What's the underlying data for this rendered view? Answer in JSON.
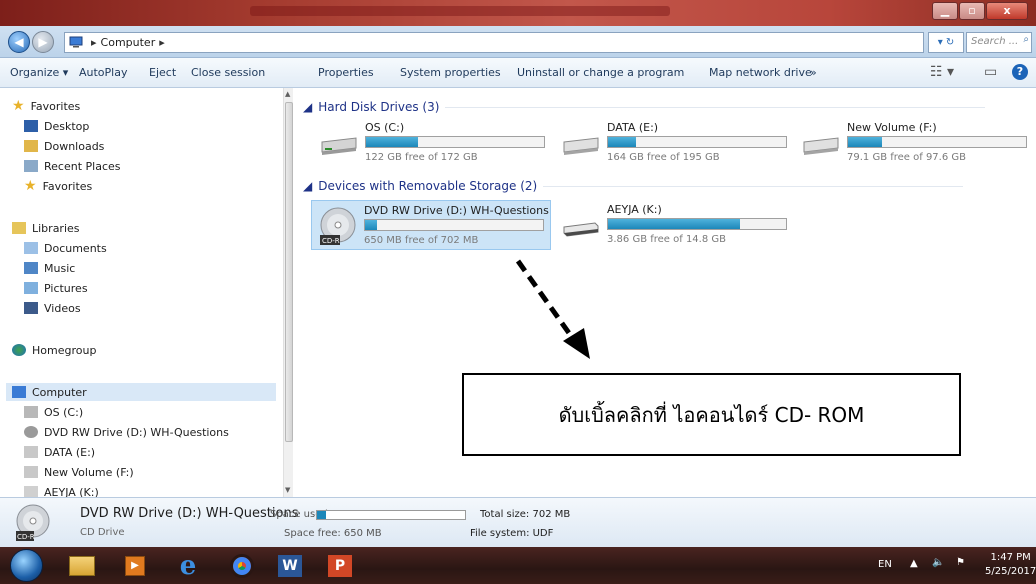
{
  "window": {
    "close_glyph": "x"
  },
  "address": {
    "crumb_sep": "▸",
    "location": "Computer",
    "search_placeholder": "Search ..."
  },
  "toolbar": {
    "items": [
      "Organize ▾",
      "AutoPlay",
      "Eject",
      "Close session",
      "Properties",
      "System properties",
      "Uninstall or change a program",
      "Map network drive",
      "»"
    ]
  },
  "nav": {
    "favorites_header": "Favorites",
    "favorites": [
      "Desktop",
      "Downloads",
      "Recent Places",
      "Favorites"
    ],
    "libraries_header": "Libraries",
    "libraries": [
      "Documents",
      "Music",
      "Pictures",
      "Videos"
    ],
    "homegroup": "Homegroup",
    "computer_header": "Computer",
    "computer": [
      "OS (C:)",
      "DVD RW Drive (D:) WH-Questions",
      "DATA (E:)",
      "New Volume (F:)",
      "AEYJA (K:)"
    ]
  },
  "groups": {
    "hdd_title": "Hard Disk Drives (3)",
    "removable_title": "Devices with Removable Storage (2)"
  },
  "drives": [
    {
      "name": "OS (C:)",
      "free": "122 GB free of 172 GB",
      "used_fraction": 0.29
    },
    {
      "name": "DATA (E:)",
      "free": "164 GB free of 195 GB",
      "used_fraction": 0.16
    },
    {
      "name": "New Volume (F:)",
      "free": "79.1 GB free of 97.6 GB",
      "used_fraction": 0.19
    },
    {
      "name": "DVD RW Drive (D:) WH-Questions",
      "free": "650 MB free of 702 MB",
      "used_fraction": 0.07,
      "disc_label": "CD-R"
    },
    {
      "name": "AEYJA (K:)",
      "free": "3.86 GB free of 14.8 GB",
      "used_fraction": 0.74
    }
  ],
  "annotation": {
    "text": "ดับเบิ้ลคลิกที่ ไอคอนไดร์ CD- ROM"
  },
  "details": {
    "title": "DVD RW Drive (D:) WH-Questions",
    "subtitle": "CD Drive",
    "space_used_label": "Space used:",
    "space_free": "Space free: 650 MB",
    "total_size": "Total size: 702 MB",
    "file_system": "File system: UDF",
    "icon_label": "CD-R"
  },
  "taskbar": {
    "lang": "EN",
    "time": "1:47 PM",
    "date": "5/25/2017"
  },
  "colors": {
    "drive_fill": "#1d87b9",
    "selection": "#cce4f7"
  }
}
